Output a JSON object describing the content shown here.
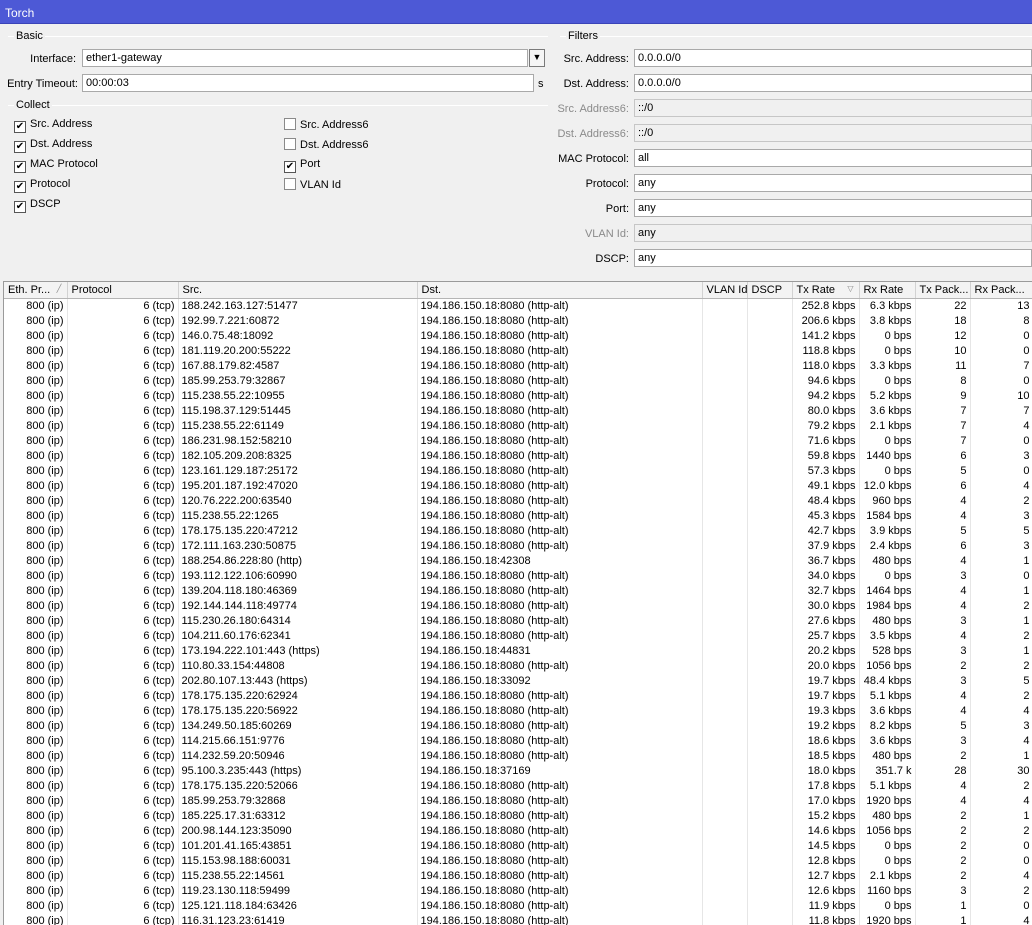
{
  "window": {
    "title": "Torch"
  },
  "basic": {
    "title": "Basic",
    "interface_label": "Interface:",
    "interface_value": "ether1-gateway",
    "entry_timeout_label": "Entry Timeout:",
    "entry_timeout_value": "00:00:03",
    "entry_timeout_unit": "s"
  },
  "collect": {
    "title": "Collect",
    "items": [
      {
        "label": "Src. Address",
        "checked": true
      },
      {
        "label": "Dst. Address",
        "checked": true
      },
      {
        "label": "MAC Protocol",
        "checked": true
      },
      {
        "label": "Protocol",
        "checked": true
      },
      {
        "label": "DSCP",
        "checked": true
      },
      {
        "label": "Src. Address6",
        "checked": false
      },
      {
        "label": "Dst. Address6",
        "checked": false
      },
      {
        "label": "Port",
        "checked": true
      },
      {
        "label": "VLAN Id",
        "checked": false
      }
    ]
  },
  "filters": {
    "title": "Filters",
    "rows": [
      {
        "label": "Src. Address:",
        "value": "0.0.0.0/0",
        "disabled": false
      },
      {
        "label": "Dst. Address:",
        "value": "0.0.0.0/0",
        "disabled": false
      },
      {
        "label": "Src. Address6:",
        "value": "::/0",
        "disabled": true
      },
      {
        "label": "Dst. Address6:",
        "value": "::/0",
        "disabled": true
      },
      {
        "label": "MAC Protocol:",
        "value": "all",
        "disabled": false
      },
      {
        "label": "Protocol:",
        "value": "any",
        "disabled": false
      },
      {
        "label": "Port:",
        "value": "any",
        "disabled": false
      },
      {
        "label": "VLAN Id:",
        "value": "any",
        "disabled": true
      },
      {
        "label": "DSCP:",
        "value": "any",
        "disabled": false
      }
    ]
  },
  "table": {
    "columns": [
      "Eth. Pr...",
      "Protocol",
      "Src.",
      "Dst.",
      "VLAN Id",
      "DSCP",
      "Tx Rate",
      "Rx Rate",
      "Tx Pack...",
      "Rx Pack..."
    ],
    "rows": [
      [
        "800 (ip)",
        "6 (tcp)",
        "188.242.163.127:51477",
        "194.186.150.18:8080 (http-alt)",
        "",
        "",
        "252.8 kbps",
        "6.3 kbps",
        "22",
        "13"
      ],
      [
        "800 (ip)",
        "6 (tcp)",
        "192.99.7.221:60872",
        "194.186.150.18:8080 (http-alt)",
        "",
        "",
        "206.6 kbps",
        "3.8 kbps",
        "18",
        "8"
      ],
      [
        "800 (ip)",
        "6 (tcp)",
        "146.0.75.48:18092",
        "194.186.150.18:8080 (http-alt)",
        "",
        "",
        "141.2 kbps",
        "0 bps",
        "12",
        "0"
      ],
      [
        "800 (ip)",
        "6 (tcp)",
        "181.119.20.200:55222",
        "194.186.150.18:8080 (http-alt)",
        "",
        "",
        "118.8 kbps",
        "0 bps",
        "10",
        "0"
      ],
      [
        "800 (ip)",
        "6 (tcp)",
        "167.88.179.82:4587",
        "194.186.150.18:8080 (http-alt)",
        "",
        "",
        "118.0 kbps",
        "3.3 kbps",
        "11",
        "7"
      ],
      [
        "800 (ip)",
        "6 (tcp)",
        "185.99.253.79:32867",
        "194.186.150.18:8080 (http-alt)",
        "",
        "",
        "94.6 kbps",
        "0 bps",
        "8",
        "0"
      ],
      [
        "800 (ip)",
        "6 (tcp)",
        "115.238.55.22:10955",
        "194.186.150.18:8080 (http-alt)",
        "",
        "",
        "94.2 kbps",
        "5.2 kbps",
        "9",
        "10"
      ],
      [
        "800 (ip)",
        "6 (tcp)",
        "115.198.37.129:51445",
        "194.186.150.18:8080 (http-alt)",
        "",
        "",
        "80.0 kbps",
        "3.6 kbps",
        "7",
        "7"
      ],
      [
        "800 (ip)",
        "6 (tcp)",
        "115.238.55.22:61149",
        "194.186.150.18:8080 (http-alt)",
        "",
        "",
        "79.2 kbps",
        "2.1 kbps",
        "7",
        "4"
      ],
      [
        "800 (ip)",
        "6 (tcp)",
        "186.231.98.152:58210",
        "194.186.150.18:8080 (http-alt)",
        "",
        "",
        "71.6 kbps",
        "0 bps",
        "7",
        "0"
      ],
      [
        "800 (ip)",
        "6 (tcp)",
        "182.105.209.208:8325",
        "194.186.150.18:8080 (http-alt)",
        "",
        "",
        "59.8 kbps",
        "1440 bps",
        "6",
        "3"
      ],
      [
        "800 (ip)",
        "6 (tcp)",
        "123.161.129.187:25172",
        "194.186.150.18:8080 (http-alt)",
        "",
        "",
        "57.3 kbps",
        "0 bps",
        "5",
        "0"
      ],
      [
        "800 (ip)",
        "6 (tcp)",
        "195.201.187.192:47020",
        "194.186.150.18:8080 (http-alt)",
        "",
        "",
        "49.1 kbps",
        "12.0 kbps",
        "6",
        "4"
      ],
      [
        "800 (ip)",
        "6 (tcp)",
        "120.76.222.200:63540",
        "194.186.150.18:8080 (http-alt)",
        "",
        "",
        "48.4 kbps",
        "960 bps",
        "4",
        "2"
      ],
      [
        "800 (ip)",
        "6 (tcp)",
        "115.238.55.22:1265",
        "194.186.150.18:8080 (http-alt)",
        "",
        "",
        "45.3 kbps",
        "1584 bps",
        "4",
        "3"
      ],
      [
        "800 (ip)",
        "6 (tcp)",
        "178.175.135.220:47212",
        "194.186.150.18:8080 (http-alt)",
        "",
        "",
        "42.7 kbps",
        "3.9 kbps",
        "5",
        "5"
      ],
      [
        "800 (ip)",
        "6 (tcp)",
        "172.111.163.230:50875",
        "194.186.150.18:8080 (http-alt)",
        "",
        "",
        "37.9 kbps",
        "2.4 kbps",
        "6",
        "3"
      ],
      [
        "800 (ip)",
        "6 (tcp)",
        "188.254.86.228:80 (http)",
        "194.186.150.18:42308",
        "",
        "",
        "36.7 kbps",
        "480 bps",
        "4",
        "1"
      ],
      [
        "800 (ip)",
        "6 (tcp)",
        "193.112.122.106:60990",
        "194.186.150.18:8080 (http-alt)",
        "",
        "",
        "34.0 kbps",
        "0 bps",
        "3",
        "0"
      ],
      [
        "800 (ip)",
        "6 (tcp)",
        "139.204.118.180:46369",
        "194.186.150.18:8080 (http-alt)",
        "",
        "",
        "32.7 kbps",
        "1464 bps",
        "4",
        "1"
      ],
      [
        "800 (ip)",
        "6 (tcp)",
        "192.144.144.118:49774",
        "194.186.150.18:8080 (http-alt)",
        "",
        "",
        "30.0 kbps",
        "1984 bps",
        "4",
        "2"
      ],
      [
        "800 (ip)",
        "6 (tcp)",
        "115.230.26.180:64314",
        "194.186.150.18:8080 (http-alt)",
        "",
        "",
        "27.6 kbps",
        "480 bps",
        "3",
        "1"
      ],
      [
        "800 (ip)",
        "6 (tcp)",
        "104.211.60.176:62341",
        "194.186.150.18:8080 (http-alt)",
        "",
        "",
        "25.7 kbps",
        "3.5 kbps",
        "4",
        "2"
      ],
      [
        "800 (ip)",
        "6 (tcp)",
        "173.194.222.101:443 (https)",
        "194.186.150.18:44831",
        "",
        "",
        "20.2 kbps",
        "528 bps",
        "3",
        "1"
      ],
      [
        "800 (ip)",
        "6 (tcp)",
        "110.80.33.154:44808",
        "194.186.150.18:8080 (http-alt)",
        "",
        "",
        "20.0 kbps",
        "1056 bps",
        "2",
        "2"
      ],
      [
        "800 (ip)",
        "6 (tcp)",
        "202.80.107.13:443 (https)",
        "194.186.150.18:33092",
        "",
        "",
        "19.7 kbps",
        "48.4 kbps",
        "3",
        "5"
      ],
      [
        "800 (ip)",
        "6 (tcp)",
        "178.175.135.220:62924",
        "194.186.150.18:8080 (http-alt)",
        "",
        "",
        "19.7 kbps",
        "5.1 kbps",
        "4",
        "2"
      ],
      [
        "800 (ip)",
        "6 (tcp)",
        "178.175.135.220:56922",
        "194.186.150.18:8080 (http-alt)",
        "",
        "",
        "19.3 kbps",
        "3.6 kbps",
        "4",
        "4"
      ],
      [
        "800 (ip)",
        "6 (tcp)",
        "134.249.50.185:60269",
        "194.186.150.18:8080 (http-alt)",
        "",
        "",
        "19.2 kbps",
        "8.2 kbps",
        "5",
        "3"
      ],
      [
        "800 (ip)",
        "6 (tcp)",
        "114.215.66.151:9776",
        "194.186.150.18:8080 (http-alt)",
        "",
        "",
        "18.6 kbps",
        "3.6 kbps",
        "3",
        "4"
      ],
      [
        "800 (ip)",
        "6 (tcp)",
        "114.232.59.20:50946",
        "194.186.150.18:8080 (http-alt)",
        "",
        "",
        "18.5 kbps",
        "480 bps",
        "2",
        "1"
      ],
      [
        "800 (ip)",
        "6 (tcp)",
        "95.100.3.235:443 (https)",
        "194.186.150.18:37169",
        "",
        "",
        "18.0 kbps",
        "351.7 k",
        "28",
        "30"
      ],
      [
        "800 (ip)",
        "6 (tcp)",
        "178.175.135.220:52066",
        "194.186.150.18:8080 (http-alt)",
        "",
        "",
        "17.8 kbps",
        "5.1 kbps",
        "4",
        "2"
      ],
      [
        "800 (ip)",
        "6 (tcp)",
        "185.99.253.79:32868",
        "194.186.150.18:8080 (http-alt)",
        "",
        "",
        "17.0 kbps",
        "1920 bps",
        "4",
        "4"
      ],
      [
        "800 (ip)",
        "6 (tcp)",
        "185.225.17.31:63312",
        "194.186.150.18:8080 (http-alt)",
        "",
        "",
        "15.2 kbps",
        "480 bps",
        "2",
        "1"
      ],
      [
        "800 (ip)",
        "6 (tcp)",
        "200.98.144.123:35090",
        "194.186.150.18:8080 (http-alt)",
        "",
        "",
        "14.6 kbps",
        "1056 bps",
        "2",
        "2"
      ],
      [
        "800 (ip)",
        "6 (tcp)",
        "101.201.41.165:43851",
        "194.186.150.18:8080 (http-alt)",
        "",
        "",
        "14.5 kbps",
        "0 bps",
        "2",
        "0"
      ],
      [
        "800 (ip)",
        "6 (tcp)",
        "115.153.98.188:60031",
        "194.186.150.18:8080 (http-alt)",
        "",
        "",
        "12.8 kbps",
        "0 bps",
        "2",
        "0"
      ],
      [
        "800 (ip)",
        "6 (tcp)",
        "115.238.55.22:14561",
        "194.186.150.18:8080 (http-alt)",
        "",
        "",
        "12.7 kbps",
        "2.1 kbps",
        "2",
        "4"
      ],
      [
        "800 (ip)",
        "6 (tcp)",
        "119.23.130.118:59499",
        "194.186.150.18:8080 (http-alt)",
        "",
        "",
        "12.6 kbps",
        "1160 bps",
        "3",
        "2"
      ],
      [
        "800 (ip)",
        "6 (tcp)",
        "125.121.118.184:63426",
        "194.186.150.18:8080 (http-alt)",
        "",
        "",
        "11.9 kbps",
        "0 bps",
        "1",
        "0"
      ],
      [
        "800 (ip)",
        "6 (tcp)",
        "116.31.123.23:61419",
        "194.186.150.18:8080 (http-alt)",
        "",
        "",
        "11.8 kbps",
        "1920 bps",
        "1",
        "4"
      ]
    ]
  }
}
